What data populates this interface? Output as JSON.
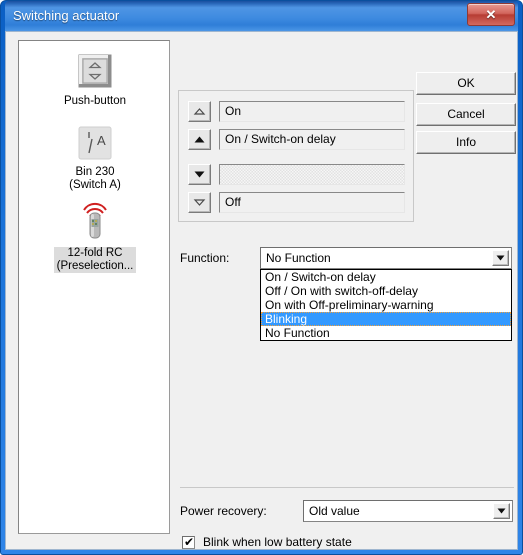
{
  "window": {
    "title": "Switching actuator",
    "close_label": "✕"
  },
  "devices": [
    {
      "icon": "push-button-icon",
      "label_line1": "Push-button",
      "label_line2": "",
      "selected": false
    },
    {
      "icon": "switch-contact-icon",
      "label_line1": "Bin 230",
      "label_line2": "(Switch A)",
      "selected": false
    },
    {
      "icon": "remote-control-icon",
      "label_line1": "12-fold RC",
      "label_line2": "(Preselection...",
      "selected": true
    }
  ],
  "scene_rows": [
    {
      "arrow": "up-thin-icon",
      "value": "On",
      "disabled": false
    },
    {
      "arrow": "up-bold-icon",
      "value": "On / Switch-on delay",
      "disabled": false
    },
    {
      "arrow": "down-bold-icon",
      "value": "",
      "disabled": true
    },
    {
      "arrow": "down-thin-icon",
      "value": "Off",
      "disabled": false
    }
  ],
  "buttons": {
    "ok": "OK",
    "cancel": "Cancel",
    "info": "Info"
  },
  "function": {
    "label": "Function:",
    "value": "No Function",
    "options": [
      "On / Switch-on delay",
      "Off / On with switch-off-delay",
      "On with Off-preliminary-warning",
      "Blinking",
      "No Function"
    ],
    "highlighted_option": "Blinking",
    "dropdown_open": true
  },
  "power_recovery": {
    "label": "Power recovery:",
    "value": "Old value"
  },
  "blink_low_battery": {
    "label": "Blink when low battery state",
    "checked": true,
    "tick": "✔"
  },
  "colors": {
    "titlebar_blue": "#2f7ed8",
    "window_border": "#1a72d8",
    "selection_blue": "#3399ff",
    "dialog_face": "#f0f0f0",
    "close_red": "#b63c33"
  }
}
